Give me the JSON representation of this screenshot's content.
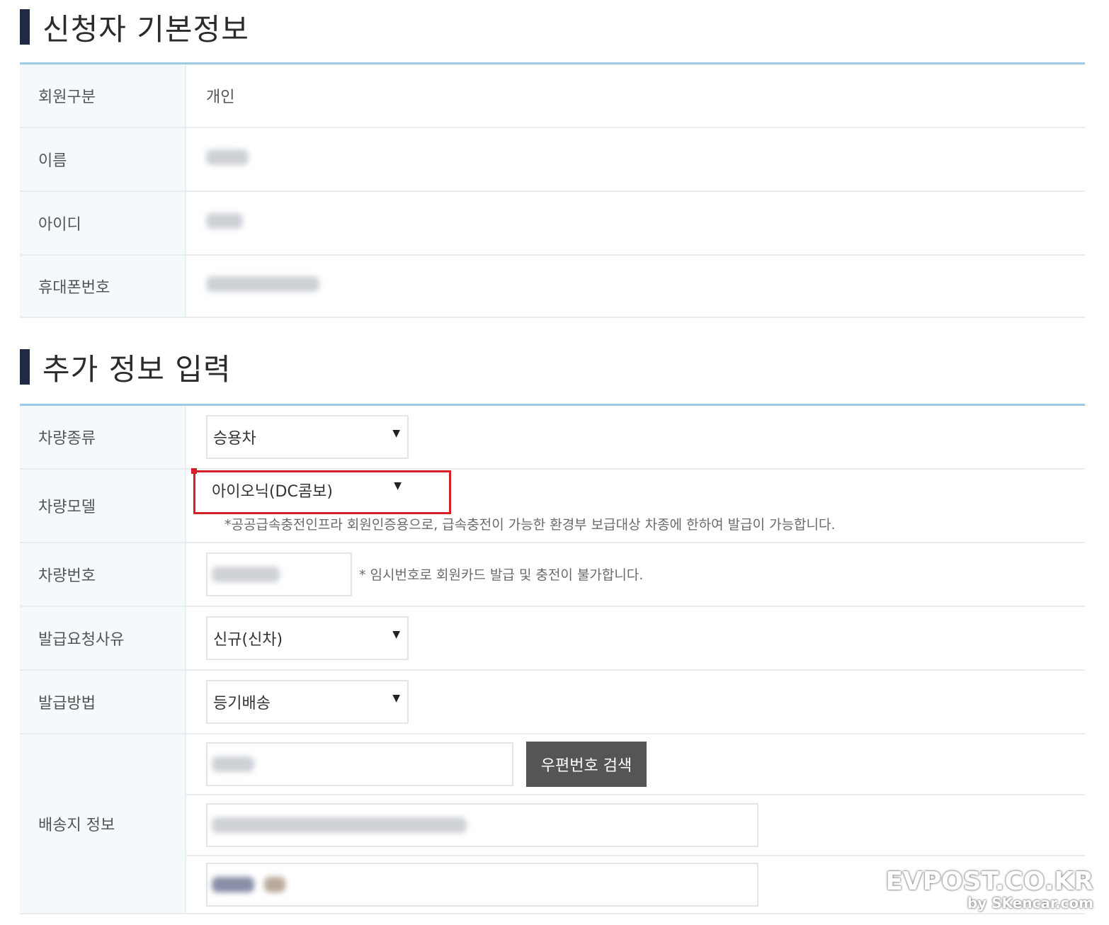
{
  "section1": {
    "title": "신청자 기본정보",
    "rows": [
      {
        "label": "회원구분",
        "value": "개인"
      },
      {
        "label": "이름"
      },
      {
        "label": "아이디"
      },
      {
        "label": "휴대폰번호"
      }
    ]
  },
  "section2": {
    "title": "추가 정보 입력",
    "vehicle_type": {
      "label": "차량종류",
      "selected": "승용차"
    },
    "vehicle_model": {
      "label": "차량모델",
      "selected": "아이오닉(DC콤보)",
      "note": "*공공급속충전인프라 회원인증용으로, 급속충전이 가능한 환경부 보급대상 차종에 한하여 발급이 가능합니다.",
      "highlight_color": "#d3202a"
    },
    "vehicle_number": {
      "label": "차량번호",
      "note": "* 임시번호로 회원카드 발급 및 충전이 불가합니다."
    },
    "issue_reason": {
      "label": "발급요청사유",
      "selected": "신규(신차)"
    },
    "issue_method": {
      "label": "발급방법",
      "selected": "등기배송"
    },
    "shipping": {
      "label": "배송지 정보",
      "zip_button": "우편번호 검색"
    }
  },
  "watermark": {
    "main": "EVPOST.CO.KR",
    "sub": "by SKencar.com"
  },
  "colors": {
    "title_bar": "#1f2a44",
    "table_top_border": "#9ccbe3",
    "label_bg": "#f4f9fc",
    "button_bg": "#555555"
  }
}
